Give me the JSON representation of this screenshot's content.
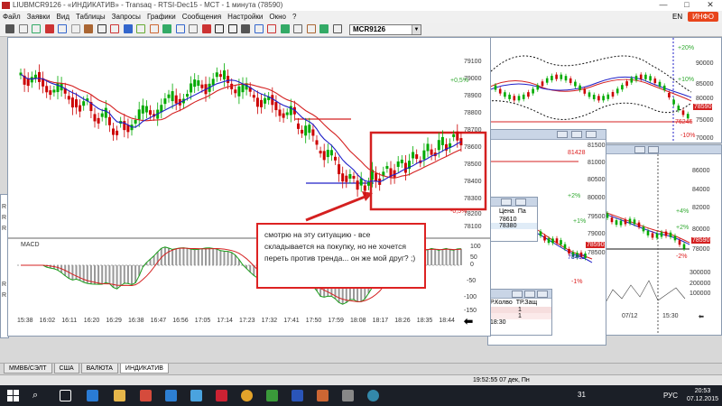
{
  "window": {
    "title": "LIUBMCR9126 - «ИНДИКАТИВ» - Transaq - RTSI-Dec15 - MCT - 1 минута (78590)",
    "min": "—",
    "max": "□",
    "close": "✕"
  },
  "menu": {
    "items": [
      "Файл",
      "Заявки",
      "Вид",
      "Таблицы",
      "Запросы",
      "Графики",
      "Сообщения",
      "Настройки",
      "Окно",
      "?"
    ],
    "language": "EN",
    "info": "ИНФО"
  },
  "toolbar": {
    "ticker": "MCR9126",
    "icons": [
      "cursor-icon",
      "crosshair-icon",
      "zoom-icon",
      "pencil-icon",
      "line-icon",
      "channel-icon",
      "fib-icon",
      "text-icon",
      "delete-icon",
      "window-icon",
      "table-icon",
      "orders-icon",
      "trades-icon",
      "portfolio-icon",
      "news-icon",
      "stop-icon",
      "sigma-icon",
      "sum-icon",
      "balance-icon",
      "quote-icon",
      "chart-icon",
      "bars-icon",
      "candles-icon",
      "settings-icon",
      "alert-icon",
      "book-icon"
    ]
  },
  "main_chart": {
    "y_ticks": [
      "79100",
      "79000",
      "78900",
      "78800",
      "78700",
      "78600",
      "78500",
      "78400",
      "78300",
      "78200",
      "78100"
    ],
    "percent_labels": [
      "+0,5%",
      "-0,5%"
    ],
    "x_ticks": [
      "15:38",
      "16:02",
      "16:11",
      "16:20",
      "16:29",
      "16:38",
      "16:47",
      "16:56",
      "17:05",
      "17:14",
      "17:23",
      "17:32",
      "17:41",
      "17:50",
      "17:59",
      "18:08",
      "18:17",
      "18:26",
      "18:35",
      "18:44"
    ],
    "macd_label": "MACD",
    "macd_ticks": [
      "100",
      "50",
      "0",
      "-50",
      "-100",
      "-150"
    ],
    "side_letters": [
      "R",
      "R",
      "R",
      "R",
      "R"
    ],
    "arrow_label": "⬅"
  },
  "callout": {
    "text": "смотрю на эту ситуацию - все складывается на покупку, но не хочется переть против тренда... он же мой друг? ;)"
  },
  "right_top_chart": {
    "y_ticks": [
      "90000",
      "85000",
      "80000",
      "75000",
      "70000"
    ],
    "labels": [
      "+20%",
      "+10%",
      "-10%",
      "+5%",
      "-5%"
    ],
    "price_tag": "78590",
    "red_value": "76245"
  },
  "mid_chart": {
    "y_ticks": [
      "81500",
      "81000",
      "80500",
      "80000",
      "79500",
      "79000",
      "78500",
      "78000"
    ],
    "labels": [
      "+2%",
      "+1%",
      "-1%",
      "-2%"
    ],
    "red_value": "81428",
    "price_tag": "78590",
    "blue_value": "78462"
  },
  "small_table": {
    "headers": [
      "Цена",
      "Па"
    ],
    "rows": [
      "78610",
      "78380"
    ]
  },
  "orders_table": {
    "headers": [
      "Р.Колво",
      "ТР.Защ"
    ],
    "rows": [
      "1",
      "1"
    ],
    "time": "18:30"
  },
  "right_bottom_chart": {
    "y_ticks": [
      "86000",
      "84000",
      "82000",
      "80000",
      "78000",
      "300000",
      "200000",
      "100000"
    ],
    "labels": [
      "+4%",
      "+2%",
      "-2%"
    ],
    "price_tag": "78590",
    "x_ticks": [
      "07/12",
      "15:30"
    ]
  },
  "bottom_tabs": [
    "ММВБ/СЭЛТ",
    "США",
    "ВАЛЮТА",
    "ИНДИКАТИВ"
  ],
  "status_bar": {
    "time": "19:52:55 07 дек, Пн"
  },
  "taskbar": {
    "clock": "20:53",
    "date": "07.12.2015",
    "lang": "РУС",
    "tray_count": "31"
  },
  "colors": {
    "candle_up": "#00aa00",
    "candle_down": "#cc0000",
    "ma_red": "#d42020",
    "ma_blue": "#2020c8",
    "highlight": "#d42020"
  }
}
